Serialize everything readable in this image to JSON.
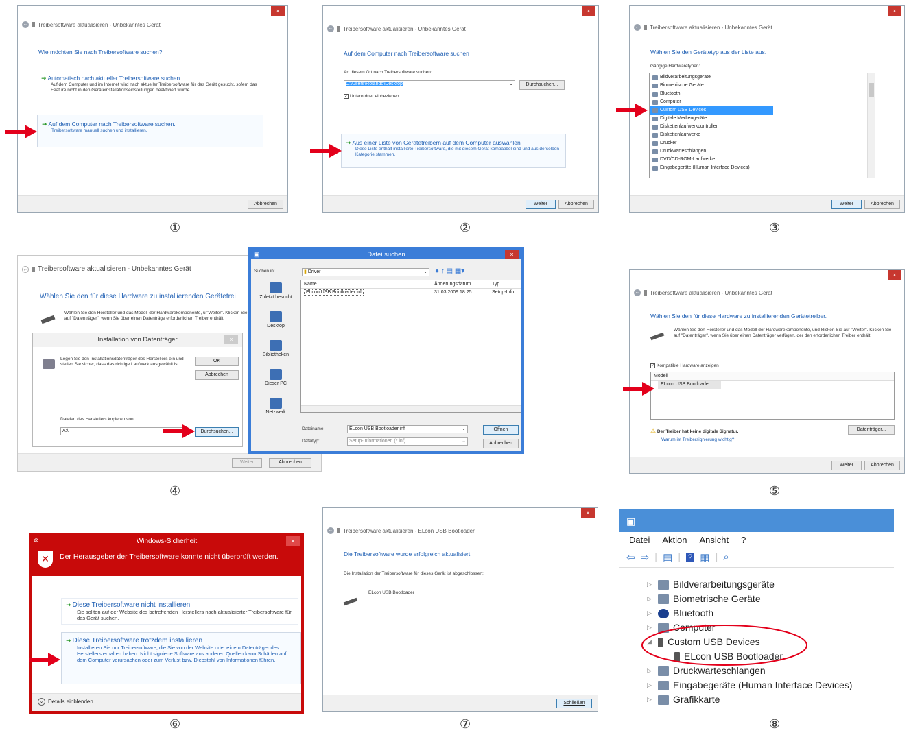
{
  "steps": [
    "①",
    "②",
    "③",
    "④",
    "⑤",
    "⑥",
    "⑦",
    "⑧"
  ],
  "common": {
    "dialog_title": "Treibersoftware aktualisieren - Unbekanntes Gerät",
    "close_glyph": "×",
    "cancel": "Abbrechen",
    "next": "Weiter",
    "browse": "Durchsuchen..."
  },
  "step1": {
    "heading": "Wie möchten Sie nach Treibersoftware suchen?",
    "opt1_title": "Automatisch nach aktueller Treibersoftware suchen",
    "opt1_desc": "Auf dem Computer und im Internet wird nach aktueller Treibersoftware für das Gerät gesucht, sofern das Feature nicht in den Geräteinstallationseinstellungen deaktiviert wurde.",
    "opt2_title": "Auf dem Computer nach Treibersoftware suchen.",
    "opt2_desc": "Treibersoftware manuell suchen und installieren."
  },
  "step2": {
    "heading": "Auf dem Computer nach Treibersoftware suchen",
    "path_label": "An diesem Ort nach Treibersoftware suchen:",
    "path_value": "C:\\Users\\Rolando\\Desktop",
    "subfolders": "Unterordner einbeziehen",
    "opt_title": "Aus einer Liste von Gerätetreibern auf dem Computer auswählen",
    "opt_desc": "Diese Liste enthält installierte Treibersoftware, die mit diesem Gerät kompatibel sind und aus derselben Kategorie stammen."
  },
  "step3": {
    "heading": "Wählen Sie den Gerätetyp aus der Liste aus.",
    "list_label": "Gängige Hardwaretypen:",
    "items": [
      "Bildverarbeitungsgeräte",
      "Biometrische Geräte",
      "Bluetooth",
      "Computer",
      "Custom USB Devices",
      "Digitale Mediengeräte",
      "Diskettenlaufwerkcontroller",
      "Diskettenlaufwerke",
      "Drucker",
      "Druckwarteschlangen",
      "DVD/CD-ROM-Laufwerke",
      "Eingabegeräte (Human Interface Devices)"
    ],
    "selected_index": 4
  },
  "step4": {
    "bg_heading": "Wählen Sie den für diese Hardware zu installierenden Gerätetrei",
    "bg_desc": "Wählen Sie den Hersteller und das Modell der Hardwarekomponente, u \"Weiter\". Klicken Sie auf \"Datenträger\", wenn Sie über einen Datenträge erforderlichen Treiber enthält.",
    "inst_title": "Installation von Datenträger",
    "inst_desc": "Legen Sie den Installationsdatenträger des Herstellers ein und stellen Sie sicher, dass das richtige Laufwerk ausgewählt ist.",
    "ok": "OK",
    "copy_label": "Dateien des Herstellers kopieren von:",
    "copy_value": "A:\\",
    "file_title": "Datei suchen",
    "lookin_label": "Suchen in:",
    "lookin_value": "Driver",
    "col_name": "Name",
    "col_date": "Änderungsdatum",
    "col_type": "Typ",
    "file_name": "ELcon USB Bootloader.inf",
    "file_date": "31.03.2009 18:25",
    "file_type": "Setup-Info",
    "places": [
      "Zuletzt besucht",
      "Desktop",
      "Bibliotheken",
      "Dieser PC",
      "Netzwerk"
    ],
    "fname_label": "Dateiname:",
    "fname_value": "ELcon USB Bootloader.inf",
    "ftype_label": "Dateityp:",
    "ftype_value": "Setup-Informationen (*.inf)",
    "open": "Öffnen"
  },
  "step5": {
    "heading": "Wählen Sie den für diese Hardware zu installierenden Gerätetreiber.",
    "desc": "Wählen Sie den Hersteller und das Modell der Hardwarekomponente, und klicken Sie auf \"Weiter\". Klicken Sie auf \"Datenträger\", wenn Sie über einen Datenträger verfügen, der den erforderlichen Treiber enthält.",
    "compat": "Kompatible Hardware anzeigen",
    "model_header": "Modell",
    "model_item": "ELcon USB Bootloader",
    "warn": "Der Treiber hat keine digitale Signatur.",
    "warn_link": "Warum ist Treibersignierung wichtig?",
    "disk": "Datenträger..."
  },
  "step6": {
    "title": "Windows-Sicherheit",
    "banner": "Der Herausgeber der Treibersoftware konnte nicht überprüft werden.",
    "opt1_title": "Diese Treibersoftware nicht installieren",
    "opt1_desc": "Sie sollten auf der Website des betreffenden Herstellers nach aktualisierter Treibersoftware für das Gerät suchen.",
    "opt2_title": "Diese Treibersoftware trotzdem installieren",
    "opt2_desc": "Installieren Sie nur Treibersoftware, die Sie von der Website oder einem Datenträger des Herstellers erhalten haben. Nicht signierte Software aus anderen Quellen kann Schäden auf dem Computer verursachen oder zum Verlust bzw. Diebstahl von Informationen führen.",
    "details": "Details einblenden"
  },
  "step7": {
    "title": "Treibersoftware aktualisieren - ELcon USB Bootloader",
    "heading": "Die Treibersoftware wurde erfolgreich aktualisiert.",
    "desc": "Die Installation der Treibersoftware für dieses Gerät ist abgeschlossen:",
    "device": "ELcon USB Bootloader",
    "close": "Schließen"
  },
  "step8": {
    "menu": [
      "Datei",
      "Aktion",
      "Ansicht",
      "?"
    ],
    "tree": [
      "Bildverarbeitungsgeräte",
      "Biometrische Geräte",
      "Bluetooth",
      "Computer",
      "Custom USB Devices",
      "ELcon USB Bootloader",
      "Druckwarteschlangen",
      "Eingabegeräte (Human Interface Devices)",
      "Grafikkarte"
    ]
  },
  "colors": {
    "accent": "#1f5fb3",
    "arrow": "#e3001b",
    "security_red": "#c80a0a",
    "titlebar_blue": "#3b7dd8"
  }
}
